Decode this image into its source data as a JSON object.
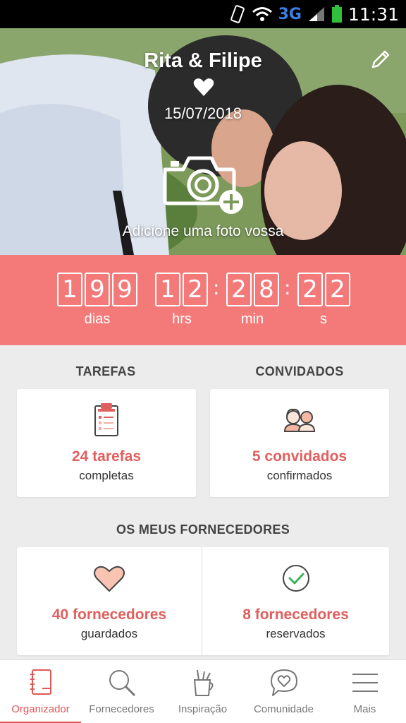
{
  "status_bar": {
    "network": "3G",
    "time": "11:31"
  },
  "hero": {
    "couple_names": "Rita & Filipe",
    "wedding_date": "15/07/2018",
    "add_photo_caption": "Adicione uma foto vossa"
  },
  "countdown": {
    "days_digits": [
      "1",
      "9",
      "9"
    ],
    "hours_digits": [
      "1",
      "2"
    ],
    "minutes_digits": [
      "2",
      "8"
    ],
    "seconds_digits": [
      "2",
      "2"
    ],
    "days_label": "dias",
    "hours_label": "hrs",
    "minutes_label": "min",
    "seconds_label": "s",
    "separator": ":"
  },
  "tasks": {
    "title": "TAREFAS",
    "count_text": "24 tarefas",
    "subtitle": "completas"
  },
  "guests": {
    "title": "CONVIDADOS",
    "count_text": "5 convidados",
    "subtitle": "confirmados"
  },
  "vendors": {
    "title": "OS MEUS FORNECEDORES",
    "saved": {
      "count_text": "40 fornecedores",
      "subtitle": "guardados"
    },
    "booked": {
      "count_text": "8 fornecedores",
      "subtitle": "reservados"
    }
  },
  "bottom_nav": [
    {
      "label": "Organizador",
      "icon": "notebook-icon",
      "active": true
    },
    {
      "label": "Fornecedores",
      "icon": "search-icon"
    },
    {
      "label": "Inspiração",
      "icon": "pencil-cup-icon"
    },
    {
      "label": "Comunidade",
      "icon": "chat-heart-icon"
    },
    {
      "label": "Mais",
      "icon": "hamburger-menu-icon"
    }
  ],
  "colors": {
    "accent": "#f47a7a",
    "accent_text": "#e0605f",
    "background": "#ececec"
  }
}
